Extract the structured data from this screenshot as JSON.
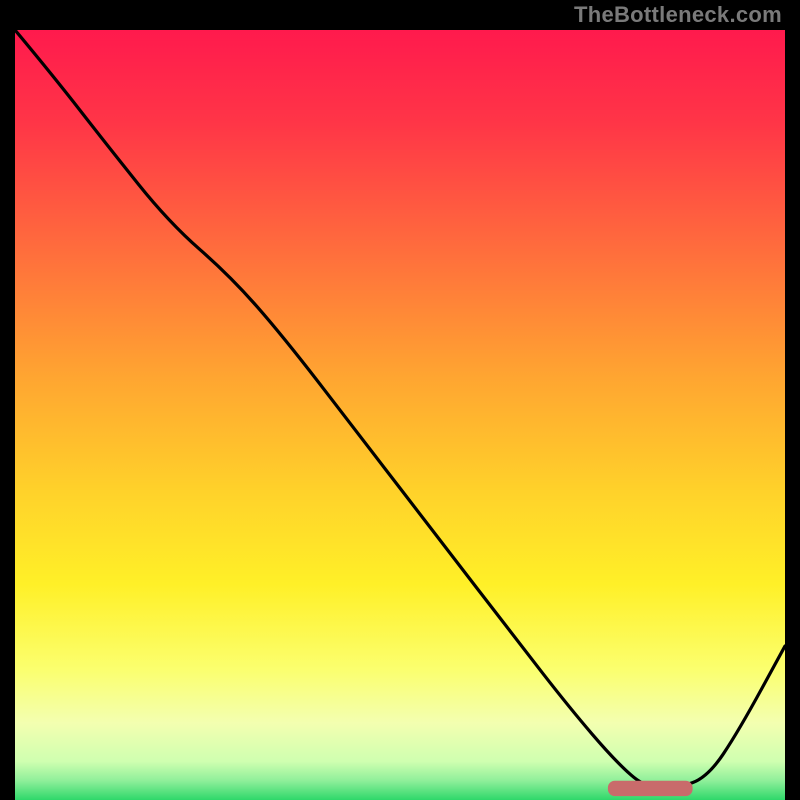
{
  "attribution": "TheBottleneck.com",
  "chart_data": {
    "type": "line",
    "title": "",
    "xlabel": "",
    "ylabel": "",
    "xlim": [
      0,
      100
    ],
    "ylim": [
      0,
      100
    ],
    "grid": false,
    "legend": false,
    "background_gradient": {
      "stops": [
        {
          "offset": 0.0,
          "color": "#ff1a4d"
        },
        {
          "offset": 0.12,
          "color": "#ff3547"
        },
        {
          "offset": 0.28,
          "color": "#ff6b3d"
        },
        {
          "offset": 0.45,
          "color": "#ffa531"
        },
        {
          "offset": 0.6,
          "color": "#ffd22a"
        },
        {
          "offset": 0.72,
          "color": "#fff028"
        },
        {
          "offset": 0.83,
          "color": "#fbff6e"
        },
        {
          "offset": 0.9,
          "color": "#f3ffb0"
        },
        {
          "offset": 0.95,
          "color": "#cfffb0"
        },
        {
          "offset": 0.975,
          "color": "#8fef9a"
        },
        {
          "offset": 1.0,
          "color": "#2fd86a"
        }
      ]
    },
    "series": [
      {
        "name": "bottleneck-curve",
        "color": "#000000",
        "x": [
          0,
          5,
          12,
          20,
          28,
          35,
          45,
          55,
          65,
          72,
          78,
          82,
          86,
          90,
          94,
          100
        ],
        "y": [
          100,
          94,
          85,
          75,
          68,
          60,
          47,
          34,
          21,
          12,
          5,
          1.5,
          1.5,
          3,
          9,
          20
        ]
      }
    ],
    "marker": {
      "name": "optimal-range",
      "color": "#c96b6b",
      "x_start": 77,
      "x_end": 88,
      "y": 1.5,
      "thickness": 2.0
    }
  }
}
